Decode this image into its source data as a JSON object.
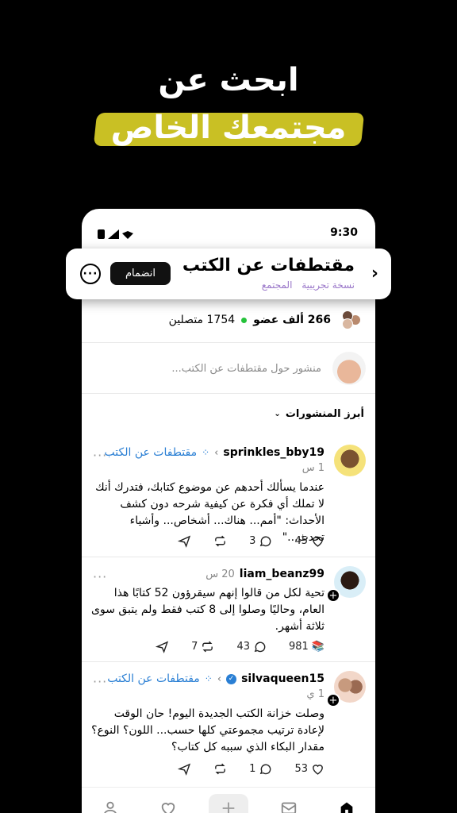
{
  "hero": {
    "line1": "ابحث عن",
    "line2": "مجتمعك الخاص"
  },
  "status": {
    "time": "9:30"
  },
  "community": {
    "back_icon": "chevron-right-icon",
    "title": "مقتطفات عن الكتب",
    "sub_trial": "نسخة تجريبية",
    "sub_community": "المجتمع",
    "join_label": "انضمام",
    "members_count": "266 ألف عضو",
    "online_count": "1754 متصلين",
    "online_color": "#25c23a"
  },
  "composer": {
    "placeholder": "منشور حول مقتطفات عن الكتب..."
  },
  "sort": {
    "label": "أبرز المنشورات"
  },
  "posts": [
    {
      "user": "sprinkles_bby19",
      "community": "مقتطفات عن الكتب",
      "time": "1 س",
      "text": "عندما يسألك أحدهم عن موضوع كتابك، فتدرك أنك لا تملك أي فكرة عن كيفية شرحه دون كشف الأحداث: \"أمم... هناك... أشخاص... وأشياء تحدث...\"",
      "likes": "45",
      "comments": "3"
    },
    {
      "user": "liam_beanz99",
      "time": "20 س",
      "text": "تحية لكل من قالوا إنهم سيقرؤون 52 كتابًا هذا العام، وحاليًا وصلوا إلى 8 كتب فقط ولم يتبق سوى ثلاثة أشهر.",
      "likes": "981",
      "like_emoji": "📚",
      "comments": "43",
      "reposts": "7"
    },
    {
      "user": "silvaqueen15",
      "community": "مقتطفات عن الكتب",
      "time": "1 ي",
      "text": "وصلت خزانة الكتب الجديدة اليوم! حان الوقت لإعادة ترتيب مجموعتي كلها حسب... اللون؟ النوع؟ مقدار البكاء الذي سببه كل كتاب؟",
      "likes": "53",
      "comments": "1"
    }
  ],
  "colors": {
    "accent_link": "#2a7fd4",
    "highlight": "#c9c024",
    "purple_sub": "#9a77c9"
  }
}
